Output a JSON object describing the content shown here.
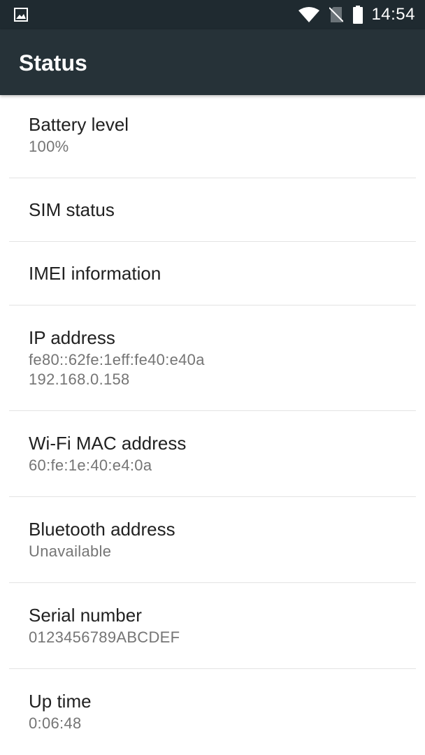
{
  "status_bar": {
    "time": "14:54",
    "notification_icon": "image-icon",
    "icons": [
      "wifi-icon",
      "no-sim-icon",
      "battery-icon"
    ]
  },
  "toolbar": {
    "title": "Status"
  },
  "items": [
    {
      "label": "Battery level",
      "value": "100%"
    },
    {
      "label": "SIM status"
    },
    {
      "label": "IMEI information"
    },
    {
      "label": "IP address",
      "value": "fe80::62fe:1eff:fe40:e40a",
      "value2": "192.168.0.158"
    },
    {
      "label": "Wi-Fi MAC address",
      "value": "60:fe:1e:40:e4:0a"
    },
    {
      "label": "Bluetooth address",
      "value": "Unavailable"
    },
    {
      "label": "Serial number",
      "value": "0123456789ABCDEF"
    },
    {
      "label": "Up time",
      "value": "0:06:48"
    }
  ],
  "colors": {
    "status_bar_bg": "#1f2a30",
    "toolbar_bg": "#263238",
    "primary_text": "#212121",
    "secondary_text": "#757575",
    "divider": "#e3e3e3"
  }
}
